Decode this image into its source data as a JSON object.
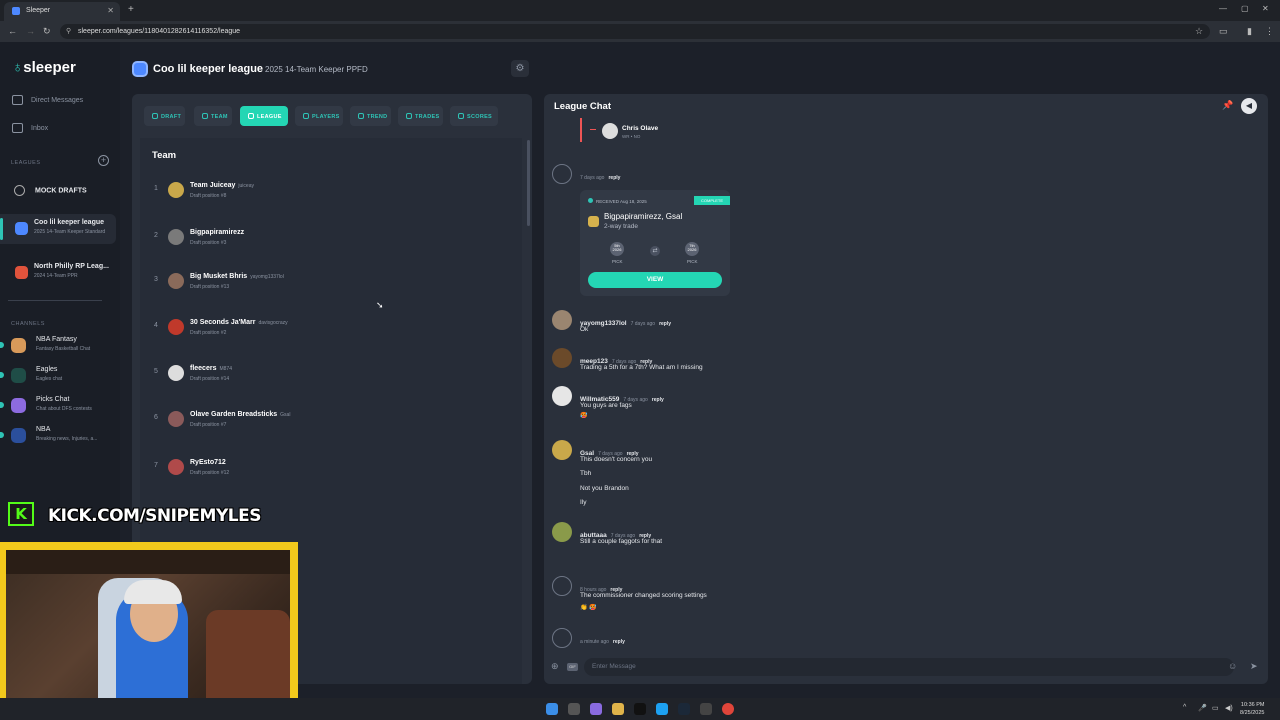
{
  "browser": {
    "tab_title": "Sleeper",
    "url": "sleeper.com/leagues/1180401282614116352/league"
  },
  "sidebar": {
    "logo": "sleeper",
    "direct_messages": "Direct Messages",
    "inbox": "Inbox",
    "leagues_header": "LEAGUES",
    "mock_drafts": "MOCK DRAFTS",
    "leagues": [
      {
        "name": "Coo lil keeper league",
        "sub": "2025 14-Team Keeper Standard"
      },
      {
        "name": "North Philly RP Leag...",
        "sub": "2024 14-Team PPR"
      }
    ],
    "channels_header": "CHANNELS",
    "channels": [
      {
        "name": "NBA Fantasy",
        "sub": "Fantasy Basketball Chat"
      },
      {
        "name": "Eagles",
        "sub": "Eagles chat"
      },
      {
        "name": "Picks Chat",
        "sub": "Chat about DFS contests"
      },
      {
        "name": "NBA",
        "sub": "Breaking news, Injuries, a..."
      }
    ]
  },
  "league": {
    "name": "Coo lil keeper league",
    "subtitle": "2025 14-Team Keeper PPFD"
  },
  "nav": [
    "DRAFT",
    "TEAM",
    "LEAGUE",
    "PLAYERS",
    "TREND",
    "TRADES",
    "SCORES"
  ],
  "team_section": {
    "title": "Team",
    "rows": [
      {
        "num": "1",
        "name": "Team Juiceay",
        "user": "juiceay",
        "dp": "Draft position #8"
      },
      {
        "num": "2",
        "name": "Bigpapiramirezz",
        "user": "",
        "dp": "Draft position #3"
      },
      {
        "num": "3",
        "name": "Big Musket Bhris",
        "user": "yayomg1337lol",
        "dp": "Draft position #13"
      },
      {
        "num": "4",
        "name": "30 Seconds Ja'Marr",
        "user": "davisgocrazy",
        "dp": "Draft position #2"
      },
      {
        "num": "5",
        "name": "fleecers",
        "user": "M874",
        "dp": "Draft position #14"
      },
      {
        "num": "6",
        "name": "Olave Garden Breadsticks",
        "user": "Gsal",
        "dp": "Draft position #7"
      },
      {
        "num": "7",
        "name": "RyEsto712",
        "user": "",
        "dp": "Draft position #12"
      }
    ]
  },
  "chat": {
    "title": "League Chat",
    "quoted_player": {
      "name": "Chris Olave",
      "sub": "WR • NO"
    },
    "trade": {
      "received": "RECEIVED Aug 18, 2025",
      "badge": "COMPLETE",
      "who": "Bigpapiramirezz, Gsal",
      "kind": "2-way trade",
      "pick1": "5th 2026",
      "pick2": "7th 2026",
      "pick_label": "PICK",
      "view": "VIEW"
    },
    "messages": [
      {
        "author": "",
        "time": "7 days ago",
        "reply": "reply",
        "lines": []
      },
      {
        "author": "yayomg1337lol",
        "time": "7 days ago",
        "reply": "reply",
        "lines": [
          "Ok"
        ]
      },
      {
        "author": "meep123",
        "time": "7 days ago",
        "reply": "reply",
        "lines": [
          "Trading a 5th for a 7th? What am I missing"
        ]
      },
      {
        "author": "Willmatic559",
        "time": "7 days ago",
        "reply": "reply",
        "lines": [
          "You guys are fags"
        ]
      },
      {
        "author": "Gsal",
        "time": "7 days ago",
        "reply": "reply",
        "lines": [
          "This doesn't concern you",
          "Tbh",
          "Not you Brandon",
          "Ily"
        ]
      },
      {
        "author": "abuttaaa",
        "time": "7 days ago",
        "reply": "reply",
        "lines": [
          "Still a couple faggots for that"
        ]
      },
      {
        "author": "",
        "time": "8 hours ago",
        "reply": "reply",
        "lines": [
          "The commissioner changed scoring settings"
        ]
      },
      {
        "author": "",
        "time": "a minute ago",
        "reply": "reply",
        "lines": []
      }
    ],
    "input_placeholder": "Enter Message",
    "gif": "GIF"
  },
  "overlay": {
    "kick_text": "KICK.COM/SNIPEMYLES",
    "kick_logo": "K"
  },
  "taskbar": {
    "time": "10:36 PM",
    "date": "8/25/2025"
  }
}
